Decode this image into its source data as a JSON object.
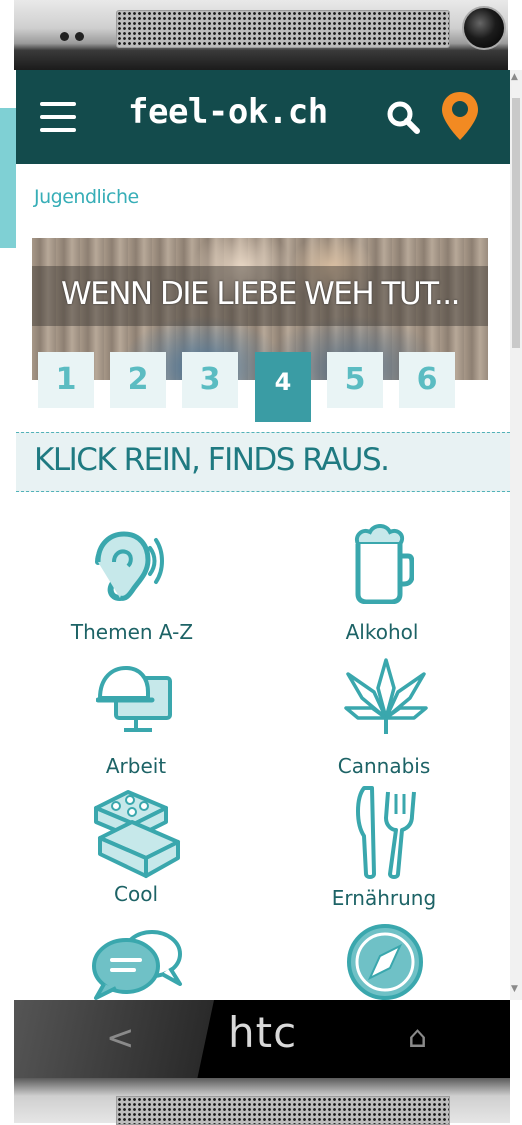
{
  "header": {
    "logo": "feel-ok.ch",
    "menu_icon": "hamburger-icon",
    "search_icon": "search-icon",
    "location_icon": "map-pin-icon"
  },
  "breadcrumb": "Jugendliche",
  "banner": {
    "title": "WENN DIE LIEBE WEH TUT...",
    "pages": [
      "1",
      "2",
      "3",
      "4",
      "5",
      "6"
    ],
    "active_page": "4"
  },
  "claim": "KLICK REIN, FINDS RAUS.",
  "tiles": [
    {
      "label": "Themen A-Z",
      "icon": "ear-icon"
    },
    {
      "label": "Alkohol",
      "icon": "beer-mug-icon"
    },
    {
      "label": "Arbeit",
      "icon": "computer-helmet-icon"
    },
    {
      "label": "Cannabis",
      "icon": "cannabis-leaf-icon"
    },
    {
      "label": "Cool",
      "icon": "bricks-icon"
    },
    {
      "label": "Ernährung",
      "icon": "knife-fork-icon"
    },
    {
      "label": "",
      "icon": "chat-bubbles-icon"
    },
    {
      "label": "",
      "icon": "compass-icon"
    }
  ],
  "system_nav": {
    "back": "<",
    "brand": "htc",
    "home": "⌂"
  },
  "colors": {
    "header": "#134b4c",
    "accent": "#37aeb7",
    "pin": "#f28a22"
  }
}
